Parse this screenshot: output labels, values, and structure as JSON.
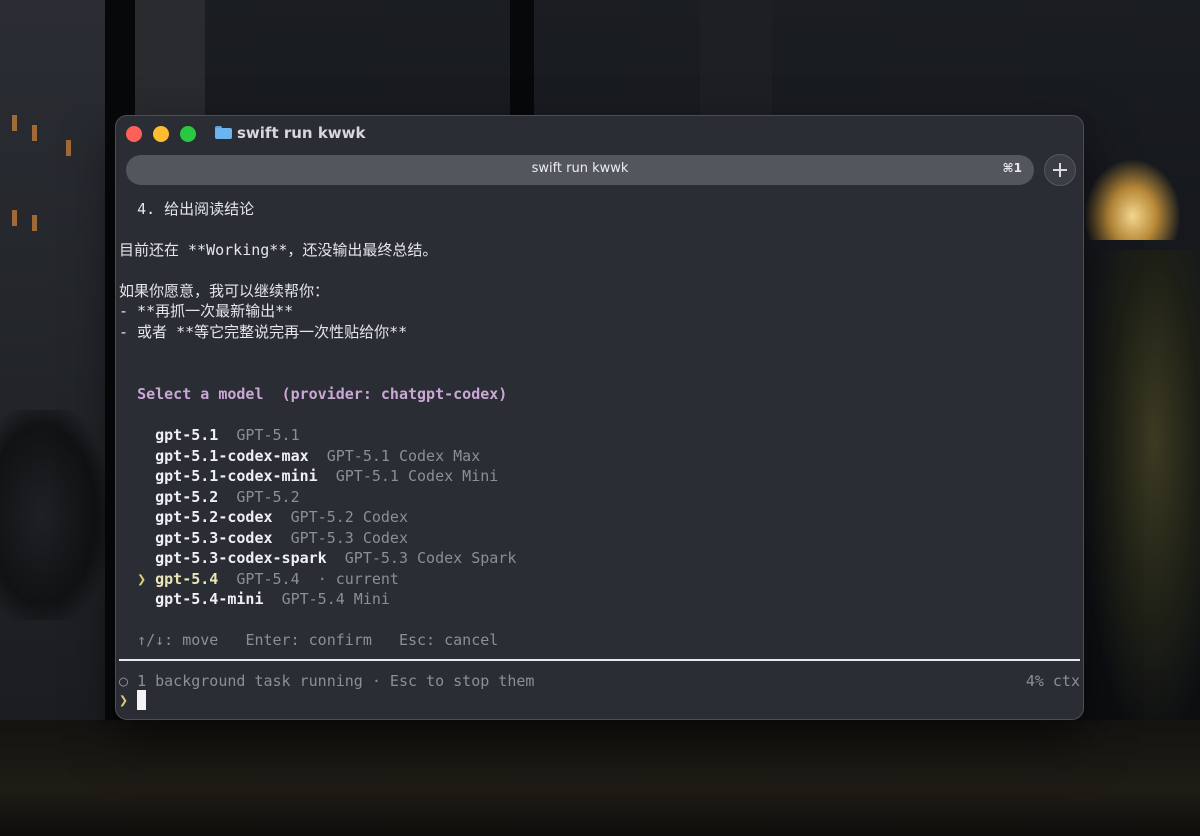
{
  "window": {
    "title": "swift run kwwk",
    "tab_title": "swift run kwwk",
    "tab_shortcut": "⌘1",
    "folder_icon": "folder-icon"
  },
  "transcript": {
    "step": "4. 给出阅读结论",
    "status": "目前还在 **Working**，还没输出最终总结。",
    "offer": "如果你愿意，我可以继续帮你：",
    "option_1": "- **再抓一次最新输出**",
    "option_2": "- 或者 **等它完整说完再一次性贴给你**"
  },
  "model_picker": {
    "title": "Select a model",
    "provider": "(provider: chatgpt-codex)",
    "selected_marker": "❯",
    "models": [
      {
        "id": "gpt-5.1",
        "label": "GPT-5.1",
        "note": ""
      },
      {
        "id": "gpt-5.1-codex-max",
        "label": "GPT-5.1 Codex Max",
        "note": ""
      },
      {
        "id": "gpt-5.1-codex-mini",
        "label": "GPT-5.1 Codex Mini",
        "note": ""
      },
      {
        "id": "gpt-5.2",
        "label": "GPT-5.2",
        "note": ""
      },
      {
        "id": "gpt-5.2-codex",
        "label": "GPT-5.2 Codex",
        "note": ""
      },
      {
        "id": "gpt-5.3-codex",
        "label": "GPT-5.3 Codex",
        "note": ""
      },
      {
        "id": "gpt-5.3-codex-spark",
        "label": "GPT-5.3 Codex Spark",
        "note": ""
      },
      {
        "id": "gpt-5.4",
        "label": "GPT-5.4",
        "note": "· current"
      },
      {
        "id": "gpt-5.4-mini",
        "label": "GPT-5.4 Mini",
        "note": ""
      }
    ],
    "help_move": "↑/↓: move",
    "help_confirm": "Enter: confirm",
    "help_cancel": "Esc: cancel"
  },
  "status_bar": {
    "circle": "○",
    "tasks": "1 background task running · Esc to stop them",
    "context": "4% ctx"
  },
  "prompt": {
    "marker": "❯",
    "value": ""
  },
  "colors": {
    "accent": "#c9a8d6",
    "selected": "#eae6b8",
    "prompt": "#d9cc7a",
    "background": "#2a2d33"
  }
}
